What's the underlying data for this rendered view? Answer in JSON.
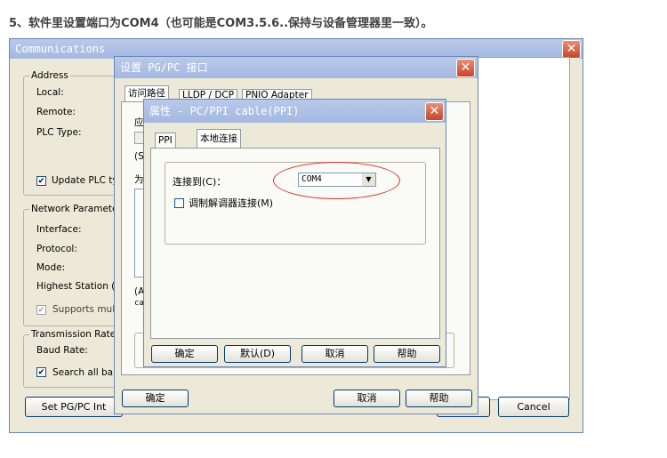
{
  "caption": "5、软件里设置端口为COM4（也可能是COM3.5.6..保持与设备管理器里一致）。",
  "comm": {
    "title": "Communications",
    "address_group": "Address",
    "local_label": "Local:",
    "remote_label": "Remote:",
    "plc_type_label": "PLC Type:",
    "update_plc_label": "Update PLC ty",
    "network_group": "Network Parameter",
    "interface_label": "Interface:",
    "protocol_label": "Protocol:",
    "mode_label": "Mode:",
    "highest_station_label": "Highest Station (H",
    "supports_multi_label": "Supports multi",
    "transmission_group": "Transmission Rate",
    "baud_rate_label": "Baud Rate:",
    "search_all_label": "Search all bau",
    "set_pgpc_button": "Set PG/PC Int",
    "cancel_button": "Cancel"
  },
  "pgpc": {
    "title": "设置 PG/PC 接口",
    "tabs": [
      "访问路径",
      "LLDP / DCP",
      "PNIO Adapter"
    ],
    "partial_labels": [
      "应",
      "(S",
      "为",
      "(A",
      "ca"
    ],
    "ok_button": "确定",
    "cancel_button": "取消",
    "help_button": "帮助"
  },
  "props": {
    "title": "属性 - PC/PPI cable(PPI)",
    "tabs": [
      "PPI",
      "本地连接"
    ],
    "connect_label": "连接到(C)：",
    "port_value": "COM4",
    "modem_label": "调制解调器连接(M)",
    "ok_button": "确定",
    "default_button": "默认(D)",
    "cancel_button": "取消",
    "help_button": "帮助"
  },
  "colors": {
    "highlight_ellipse": "#e03030",
    "titlebar": "#a4b8e0",
    "dialog_bg": "#ece9d8"
  }
}
